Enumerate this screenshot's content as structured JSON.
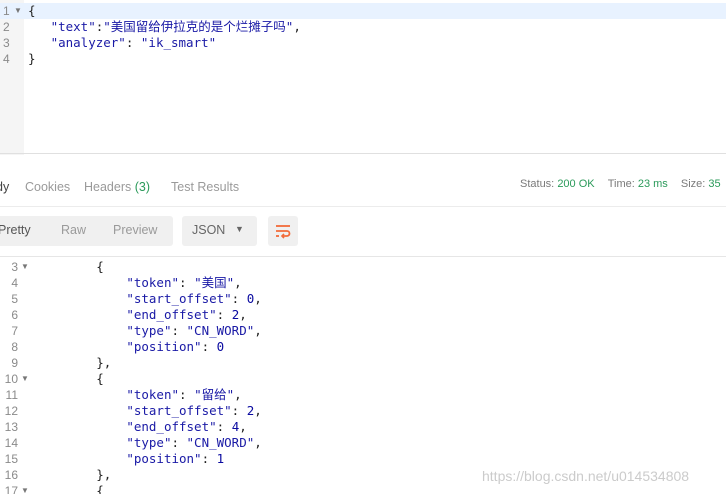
{
  "request": {
    "lines": [
      {
        "n": "1",
        "fold": true,
        "tokens": [
          {
            "t": "{",
            "c": "p"
          }
        ]
      },
      {
        "n": "2",
        "fold": false,
        "tokens": [
          {
            "t": "   ",
            "c": "p"
          },
          {
            "t": "\"text\"",
            "c": "k"
          },
          {
            "t": ":",
            "c": "p"
          },
          {
            "t": "\"美国留给伊拉克的是个烂摊子吗\"",
            "c": "s"
          },
          {
            "t": ",",
            "c": "p"
          }
        ]
      },
      {
        "n": "3",
        "fold": false,
        "tokens": [
          {
            "t": "   ",
            "c": "p"
          },
          {
            "t": "\"analyzer\"",
            "c": "k"
          },
          {
            "t": ": ",
            "c": "p"
          },
          {
            "t": "\"ik_smart\"",
            "c": "s"
          }
        ]
      },
      {
        "n": "4",
        "fold": false,
        "tokens": [
          {
            "t": "}",
            "c": "p"
          }
        ]
      }
    ]
  },
  "response_tabs": {
    "body_label": "dy",
    "cookies_label": "Cookies",
    "headers_label": "Headers",
    "headers_count": "(3)",
    "tests_label": "Test Results"
  },
  "status_bar": {
    "status_label": "Status:",
    "status_value": "200 OK",
    "time_label": "Time:",
    "time_value": "23 ms",
    "size_label": "Size:",
    "size_value": "35"
  },
  "toolbar": {
    "pretty": "Pretty",
    "raw": "Raw",
    "preview": "Preview",
    "format_selected": "JSON",
    "wrap_icon": "wrap-lines-icon",
    "accent_color": "#f26b3a"
  },
  "response": {
    "lines": [
      {
        "n": "3",
        "fold": true,
        "tokens": [
          {
            "t": "        {",
            "c": "p"
          }
        ]
      },
      {
        "n": "4",
        "fold": false,
        "tokens": [
          {
            "t": "            ",
            "c": "p"
          },
          {
            "t": "\"token\"",
            "c": "k"
          },
          {
            "t": ": ",
            "c": "p"
          },
          {
            "t": "\"美国\"",
            "c": "s"
          },
          {
            "t": ",",
            "c": "p"
          }
        ]
      },
      {
        "n": "5",
        "fold": false,
        "tokens": [
          {
            "t": "            ",
            "c": "p"
          },
          {
            "t": "\"start_offset\"",
            "c": "k"
          },
          {
            "t": ": ",
            "c": "p"
          },
          {
            "t": "0",
            "c": "num"
          },
          {
            "t": ",",
            "c": "p"
          }
        ]
      },
      {
        "n": "6",
        "fold": false,
        "tokens": [
          {
            "t": "            ",
            "c": "p"
          },
          {
            "t": "\"end_offset\"",
            "c": "k"
          },
          {
            "t": ": ",
            "c": "p"
          },
          {
            "t": "2",
            "c": "num"
          },
          {
            "t": ",",
            "c": "p"
          }
        ]
      },
      {
        "n": "7",
        "fold": false,
        "tokens": [
          {
            "t": "            ",
            "c": "p"
          },
          {
            "t": "\"type\"",
            "c": "k"
          },
          {
            "t": ": ",
            "c": "p"
          },
          {
            "t": "\"CN_WORD\"",
            "c": "s"
          },
          {
            "t": ",",
            "c": "p"
          }
        ]
      },
      {
        "n": "8",
        "fold": false,
        "tokens": [
          {
            "t": "            ",
            "c": "p"
          },
          {
            "t": "\"position\"",
            "c": "k"
          },
          {
            "t": ": ",
            "c": "p"
          },
          {
            "t": "0",
            "c": "num"
          }
        ]
      },
      {
        "n": "9",
        "fold": false,
        "tokens": [
          {
            "t": "        },",
            "c": "p"
          }
        ]
      },
      {
        "n": "10",
        "fold": true,
        "tokens": [
          {
            "t": "        {",
            "c": "p"
          }
        ]
      },
      {
        "n": "11",
        "fold": false,
        "tokens": [
          {
            "t": "            ",
            "c": "p"
          },
          {
            "t": "\"token\"",
            "c": "k"
          },
          {
            "t": ": ",
            "c": "p"
          },
          {
            "t": "\"留给\"",
            "c": "s"
          },
          {
            "t": ",",
            "c": "p"
          }
        ]
      },
      {
        "n": "12",
        "fold": false,
        "tokens": [
          {
            "t": "            ",
            "c": "p"
          },
          {
            "t": "\"start_offset\"",
            "c": "k"
          },
          {
            "t": ": ",
            "c": "p"
          },
          {
            "t": "2",
            "c": "num"
          },
          {
            "t": ",",
            "c": "p"
          }
        ]
      },
      {
        "n": "13",
        "fold": false,
        "tokens": [
          {
            "t": "            ",
            "c": "p"
          },
          {
            "t": "\"end_offset\"",
            "c": "k"
          },
          {
            "t": ": ",
            "c": "p"
          },
          {
            "t": "4",
            "c": "num"
          },
          {
            "t": ",",
            "c": "p"
          }
        ]
      },
      {
        "n": "14",
        "fold": false,
        "tokens": [
          {
            "t": "            ",
            "c": "p"
          },
          {
            "t": "\"type\"",
            "c": "k"
          },
          {
            "t": ": ",
            "c": "p"
          },
          {
            "t": "\"CN_WORD\"",
            "c": "s"
          },
          {
            "t": ",",
            "c": "p"
          }
        ]
      },
      {
        "n": "15",
        "fold": false,
        "tokens": [
          {
            "t": "            ",
            "c": "p"
          },
          {
            "t": "\"position\"",
            "c": "k"
          },
          {
            "t": ": ",
            "c": "p"
          },
          {
            "t": "1",
            "c": "num"
          }
        ]
      },
      {
        "n": "16",
        "fold": false,
        "tokens": [
          {
            "t": "        },",
            "c": "p"
          }
        ]
      },
      {
        "n": "17",
        "fold": true,
        "tokens": [
          {
            "t": "        {",
            "c": "p"
          }
        ]
      }
    ]
  },
  "watermark": "https://blog.csdn.net/u014534808"
}
